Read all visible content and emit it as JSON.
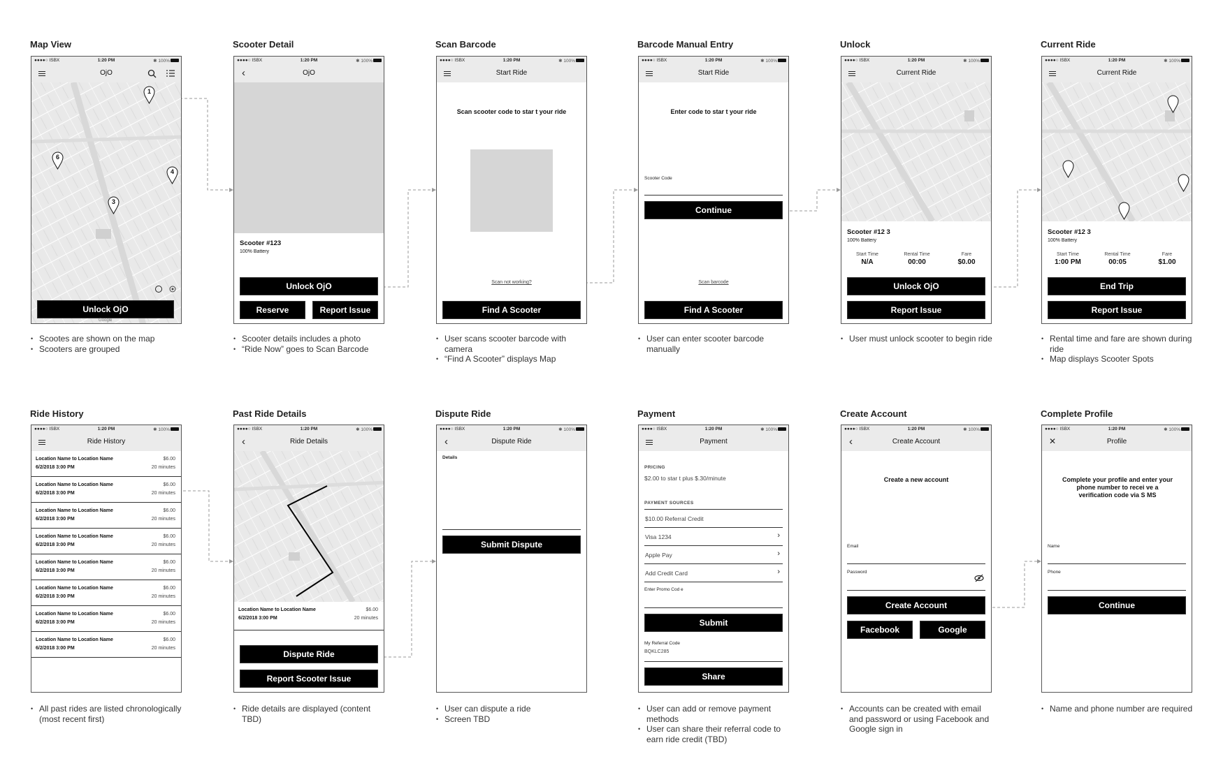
{
  "status_bar": {
    "carrier": "●●●●○ ISBX",
    "time": "1:20 PM",
    "battery": "✱ 100%"
  },
  "screens": {
    "map_view": {
      "title": "Map View",
      "nav_title": "OjO",
      "pins": [
        "1",
        "6",
        "4",
        "3"
      ],
      "unlock_button": "Unlock OjO",
      "map_attribution": "Google",
      "notes": [
        "Scootes are shown on the map",
        "Scooters are grouped"
      ]
    },
    "scooter_detail": {
      "title": "Scooter Detail",
      "nav_title": "OjO",
      "scooter_name": "Scooter #123",
      "battery": "100% Battery",
      "unlock_button": "Unlock OjO",
      "reserve_button": "Reserve",
      "report_button": "Report Issue",
      "notes": [
        "Scooter details includes a photo",
        "“Ride Now” goes to Scan Barcode"
      ]
    },
    "scan_barcode": {
      "title": "Scan Barcode",
      "nav_title": "Start Ride",
      "prompt": "Scan scooter code to star t your ride",
      "help_link": "Scan not working?",
      "find_button": "Find A Scooter",
      "notes": [
        "User scans scooter barcode with camera",
        "“Find A Scooter” displays Map"
      ]
    },
    "manual_entry": {
      "title": "Barcode Manual Entry",
      "nav_title": "Start Ride",
      "prompt": "Enter code to star t your ride",
      "field_label": "Scooter Code",
      "continue_button": "Continue",
      "scan_link": "Scan barcode",
      "find_button": "Find A Scooter",
      "notes": [
        "User can enter scooter barcode manually"
      ]
    },
    "unlock": {
      "title": "Unlock",
      "nav_title": "Current Ride",
      "scooter_name": "Scooter #12 3",
      "battery": "100% Battery",
      "stats": [
        {
          "label": "Start Time",
          "value": "N/A"
        },
        {
          "label": "Rental Time",
          "value": "00:00"
        },
        {
          "label": "Fare",
          "value": "$0.00"
        }
      ],
      "primary_button": "Unlock OjO",
      "report_button": "Report Issue",
      "notes": [
        "User must unlock scooter to begin ride"
      ]
    },
    "current_ride": {
      "title": "Current Ride",
      "nav_title": "Current Ride",
      "scooter_name": "Scooter #12 3",
      "battery": "100% Battery",
      "stats": [
        {
          "label": "Start Time",
          "value": "1:00 PM"
        },
        {
          "label": "Rental Time",
          "value": "00:05"
        },
        {
          "label": "Fare",
          "value": "$1.00"
        }
      ],
      "primary_button": "End Trip",
      "report_button": "Report Issue",
      "notes": [
        "Rental time and fare are shown during ride",
        "Map displays Scooter Spots"
      ]
    },
    "ride_history": {
      "title": "Ride History",
      "nav_title": "Ride History",
      "rides": [
        {
          "route": "Location Name to  Location Name",
          "datetime": "6/2/2018 3:00 PM",
          "price": "$6.00",
          "duration": "20 minutes"
        },
        {
          "route": "Location Name to  Location Name",
          "datetime": "6/2/2018 3:00 PM",
          "price": "$6.00",
          "duration": "20 minutes"
        },
        {
          "route": "Location Name to  Location Name",
          "datetime": "6/2/2018 3:00 PM",
          "price": "$6.00",
          "duration": "20 minutes"
        },
        {
          "route": "Location Name to  Location Name",
          "datetime": "6/2/2018 3:00 PM",
          "price": "$6.00",
          "duration": "20 minutes"
        },
        {
          "route": "Location Name to  Location Name",
          "datetime": "6/2/2018 3:00 PM",
          "price": "$6.00",
          "duration": "20 minutes"
        },
        {
          "route": "Location Name to  Location Name",
          "datetime": "6/2/2018 3:00 PM",
          "price": "$6.00",
          "duration": "20 minutes"
        },
        {
          "route": "Location Name to  Location Name",
          "datetime": "6/2/2018 3:00 PM",
          "price": "$6.00",
          "duration": "20 minutes"
        },
        {
          "route": "Location Name to  Location Name",
          "datetime": "6/2/2018 3:00 PM",
          "price": "$6.00",
          "duration": "20 minutes"
        }
      ],
      "notes": [
        "All past rides are listed chronologically (most recent first)"
      ]
    },
    "past_ride": {
      "title": "Past Ride Details",
      "nav_title": "Ride Details",
      "ride": {
        "route": "Location Name to  Location Name",
        "datetime": "6/2/2018 3:00 PM",
        "price": "$6.00",
        "duration": "20 minutes"
      },
      "dispute_button": "Dispute Ride",
      "report_button": "Report Scooter Issue",
      "notes": [
        "Ride details are displayed (content TBD)"
      ]
    },
    "dispute": {
      "title": "Dispute Ride",
      "nav_title": "Dispute Ride",
      "details_label": "Details",
      "submit_button": "Submit Dispute",
      "notes": [
        "User can dispute a ride",
        "Screen TBD"
      ]
    },
    "payment": {
      "title": "Payment",
      "nav_title": "Payment",
      "pricing_header": "PRICING",
      "pricing_text": "$2.00 to star t plus $.30/minute",
      "sources_header": "PAYMENT SOURCES",
      "sources": [
        {
          "label": "$10.00 Referral Credit",
          "chevron": false
        },
        {
          "label": "Visa 1234",
          "chevron": true
        },
        {
          "label": "Apple Pay",
          "chevron": true
        },
        {
          "label": "Add Credit Card",
          "chevron": true
        }
      ],
      "promo_label": "Enter Promo Cod e",
      "submit_button": "Submit",
      "referral_label": "My Referral Code",
      "referral_code": "BQKLC285",
      "share_button": "Share",
      "notes": [
        "User can add or remove payment methods",
        "User can share their referral code to earn ride credit (TBD)"
      ]
    },
    "create_account": {
      "title": "Create Account",
      "nav_title": "Create Account",
      "heading": "Create a new account",
      "email_label": "Email",
      "password_label": "Password",
      "create_button": "Create Account",
      "facebook_button": "Facebook",
      "google_button": "Google",
      "notes": [
        "Accounts can be created with email and password or using Facebook and Google sign in"
      ]
    },
    "profile": {
      "title": "Complete Profile",
      "nav_title": "Profile",
      "heading": "Complete your profile and enter your phone number to recei ve a verification code via S MS",
      "name_label": "Name",
      "phone_label": "Phone",
      "continue_button": "Continue",
      "notes": [
        "Name and phone number are required"
      ]
    }
  }
}
